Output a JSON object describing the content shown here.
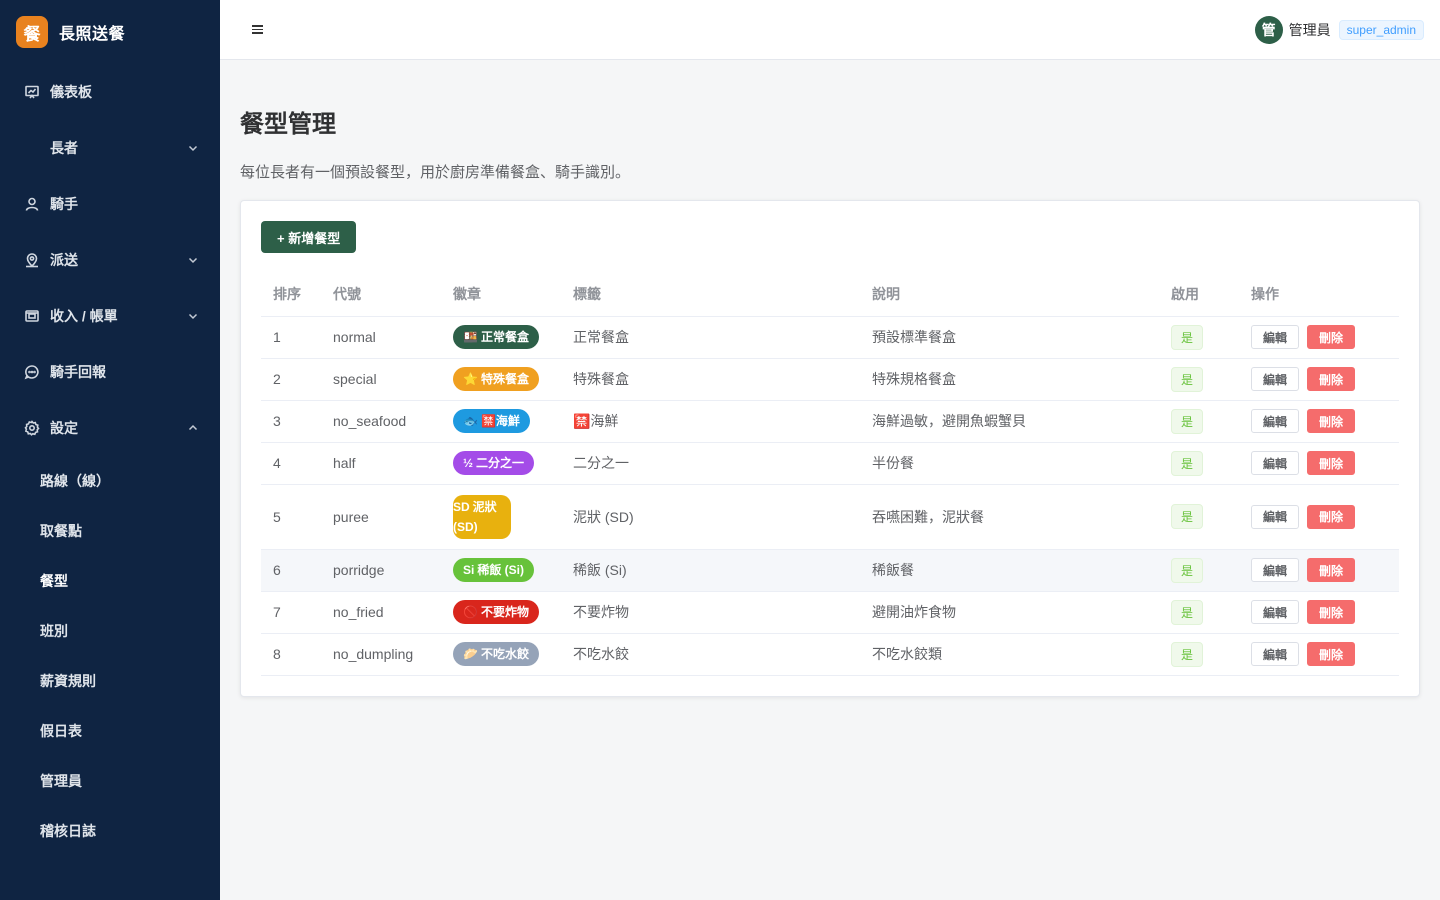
{
  "brand": {
    "logo_char": "餐",
    "name": "長照送餐",
    "logo_color": "#e8821f"
  },
  "sidebar": {
    "items": [
      {
        "label": "儀表板",
        "icon": "dashboard-icon"
      },
      {
        "label": "長者",
        "icon": "none",
        "expandable": true
      },
      {
        "label": "騎手",
        "icon": "user-icon"
      },
      {
        "label": "派送",
        "icon": "location-icon",
        "expandable": true
      },
      {
        "label": "收入 / 帳單",
        "icon": "wallet-icon",
        "expandable": true
      },
      {
        "label": "騎手回報",
        "icon": "chat-icon"
      },
      {
        "label": "設定",
        "icon": "gear-icon",
        "expanded": true
      }
    ],
    "settings_sub": [
      {
        "label": "路線（線）"
      },
      {
        "label": "取餐點"
      },
      {
        "label": "餐型",
        "active": true
      },
      {
        "label": "班別"
      },
      {
        "label": "薪資規則"
      },
      {
        "label": "假日表"
      },
      {
        "label": "管理員"
      },
      {
        "label": "稽核日誌"
      }
    ]
  },
  "header": {
    "avatar_char": "管",
    "user_name": "管理員",
    "role": "super_admin"
  },
  "page": {
    "title": "餐型管理",
    "description": "每位長者有一個預設餐型，用於廚房準備餐盒、騎手識別。",
    "add_button": "+ 新增餐型"
  },
  "table": {
    "headers": [
      "排序",
      "代號",
      "徽章",
      "標籤",
      "說明",
      "啟用",
      "操作"
    ],
    "edit_label": "編輯",
    "delete_label": "刪除",
    "rows": [
      {
        "order": "1",
        "code": "normal",
        "badge_icon": "🍱",
        "badge_text": "正常餐盒",
        "badge_color": "#2d5f48",
        "label": "正常餐盒",
        "desc": "預設標準餐盒",
        "enabled": "是"
      },
      {
        "order": "2",
        "code": "special",
        "badge_icon": "⭐",
        "badge_text": "特殊餐盒",
        "badge_color": "#f0a020",
        "label": "特殊餐盒",
        "desc": "特殊規格餐盒",
        "enabled": "是"
      },
      {
        "order": "3",
        "code": "no_seafood",
        "badge_icon": "🐟",
        "badge_text": "🈲海鮮",
        "badge_color": "#1e9ae0",
        "label": "🈲海鮮",
        "desc": "海鮮過敏，避開魚蝦蟹貝",
        "enabled": "是"
      },
      {
        "order": "4",
        "code": "half",
        "badge_icon": "½",
        "badge_text": "二分之一",
        "badge_color": "#a44ce8",
        "label": "二分之一",
        "desc": "半份餐",
        "enabled": "是"
      },
      {
        "order": "5",
        "code": "puree",
        "badge_icon": "SD",
        "badge_text": "泥狀 (SD)",
        "badge_color": "#e8b10e",
        "label": "泥狀 (SD)",
        "desc": "吞嚥困難，泥狀餐",
        "enabled": "是"
      },
      {
        "order": "6",
        "code": "porridge",
        "badge_icon": "Si",
        "badge_text": "稀飯 (Si)",
        "badge_color": "#67c23a",
        "label": "稀飯 (Si)",
        "desc": "稀飯餐",
        "enabled": "是"
      },
      {
        "order": "7",
        "code": "no_fried",
        "badge_icon": "🚫",
        "badge_text": "不要炸物",
        "badge_color": "#d9261c",
        "label": "不要炸物",
        "desc": "避開油炸食物",
        "enabled": "是"
      },
      {
        "order": "8",
        "code": "no_dumpling",
        "badge_icon": "🥟",
        "badge_text": "不吃水餃",
        "badge_color": "#95a3b8",
        "label": "不吃水餃",
        "desc": "不吃水餃類",
        "enabled": "是"
      }
    ]
  }
}
